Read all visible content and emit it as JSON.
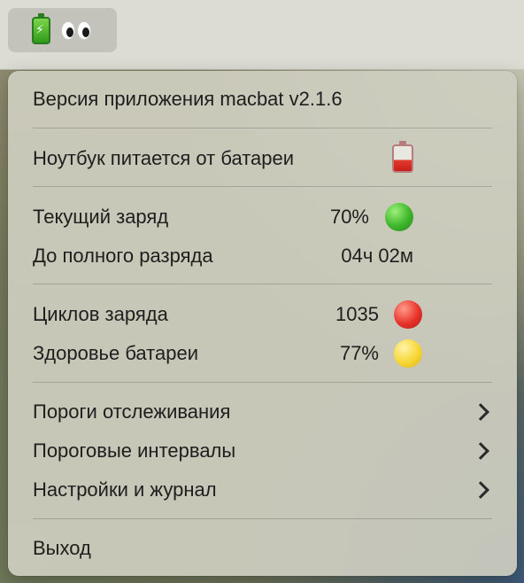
{
  "status_item": {
    "battery_icon": "green-charging-battery-icon",
    "eyes_icon": "eyes-emoji-icon"
  },
  "menu": {
    "version_label": "Версия приложения macbat v2.1.6",
    "power_source_label": "Ноутбук питается от батареи",
    "power_source_icon": "empty-battery-icon",
    "current_charge_label": "Текущий заряд",
    "current_charge_value": "70%",
    "current_charge_status": "green",
    "time_to_empty_label": "До полного разряда",
    "time_to_empty_value": "04ч 02м",
    "cycles_label": "Циклов заряда",
    "cycles_value": "1035",
    "cycles_status": "red",
    "health_label": "Здоровье батареи",
    "health_value": "77%",
    "health_status": "yellow",
    "thresholds_label": "Пороги отслеживания",
    "threshold_intervals_label": "Пороговые интервалы",
    "settings_log_label": "Настройки и журнал",
    "quit_label": "Выход"
  },
  "colors": {
    "status_green": "#3db52b",
    "status_red": "#e8332a",
    "status_yellow": "#f7d634"
  }
}
